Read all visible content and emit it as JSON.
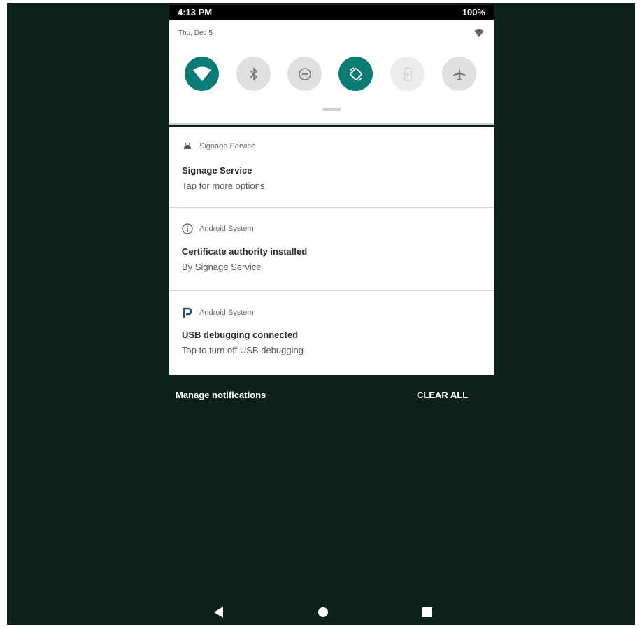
{
  "status_bar": {
    "time": "4:13 PM",
    "battery": "100%"
  },
  "quick_settings": {
    "date": "Thu, Dec 5",
    "accent_color": "#0b7b76",
    "tiles": [
      {
        "icon": "wifi-icon",
        "state": "on"
      },
      {
        "icon": "bluetooth-icon",
        "state": "off"
      },
      {
        "icon": "do-not-disturb-icon",
        "state": "off"
      },
      {
        "icon": "auto-rotate-icon",
        "state": "on"
      },
      {
        "icon": "battery-saver-icon",
        "state": "disabled"
      },
      {
        "icon": "airplane-icon",
        "state": "off"
      }
    ]
  },
  "notifications": [
    {
      "app": "Signage Service",
      "icon": "android-icon",
      "title": "Signage Service",
      "text": "Tap for more options."
    },
    {
      "app": "Android System",
      "icon": "info-icon",
      "title": "Certificate authority installed",
      "text": "By Signage Service"
    },
    {
      "app": "Android System",
      "icon": "p-logo-icon",
      "title": "USB debugging connected",
      "text": "Tap to turn off USB debugging"
    }
  ],
  "footer": {
    "manage_label": "Manage notifications",
    "clear_label": "CLEAR ALL"
  },
  "nav_bar": {
    "buttons": [
      "back-icon",
      "home-icon",
      "recents-icon"
    ]
  }
}
